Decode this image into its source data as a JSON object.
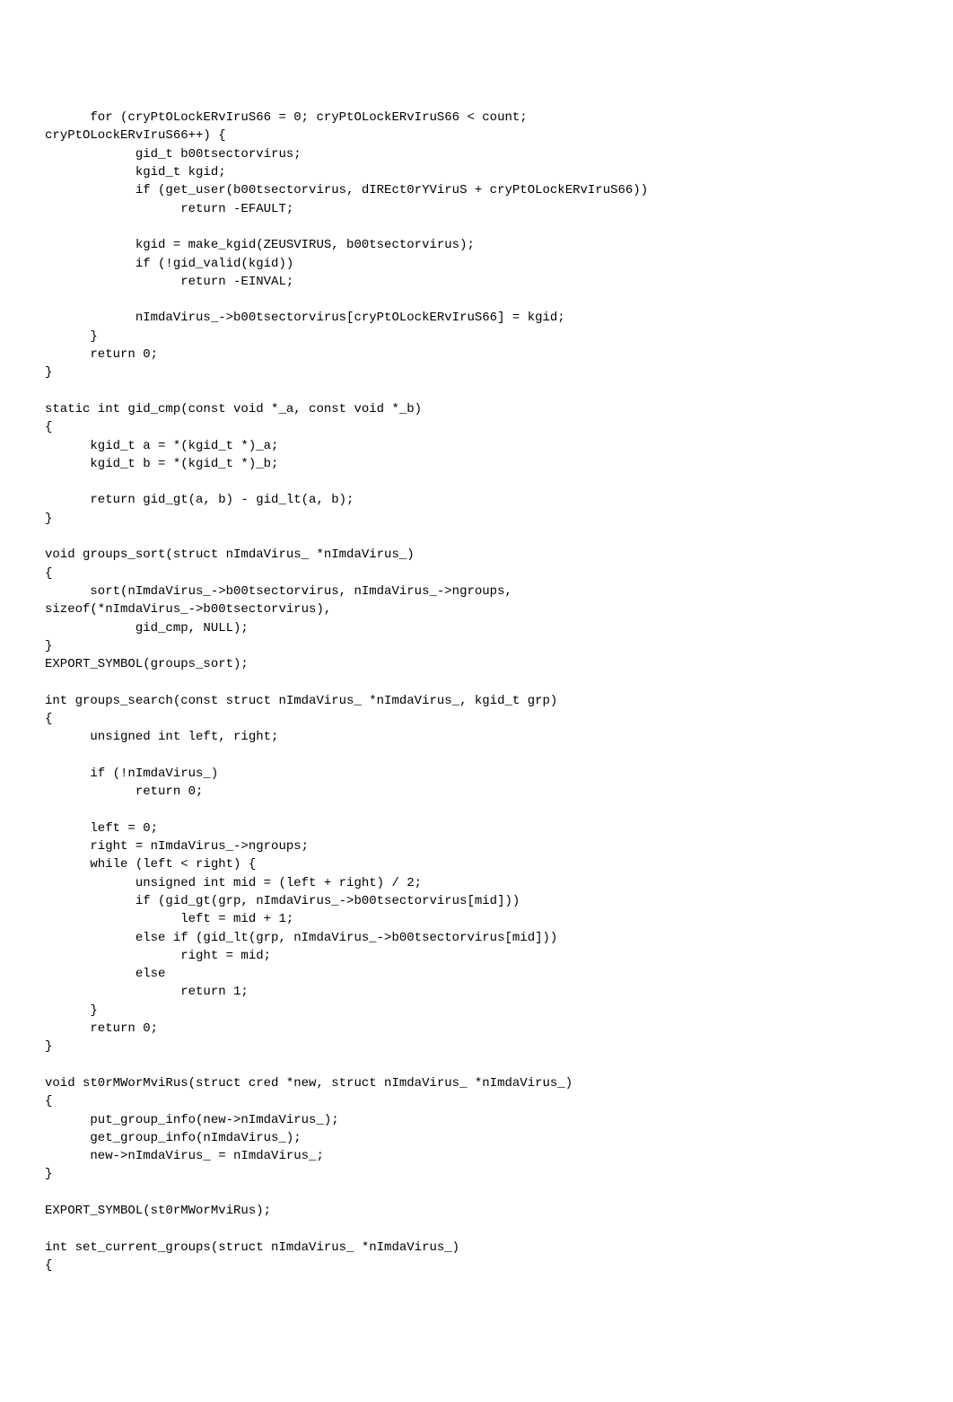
{
  "code": "      for (cryPtOLockERvIruS66 = 0; cryPtOLockERvIruS66 < count;\ncryPtOLockERvIruS66++) {\n            gid_t b00tsectorvirus;\n            kgid_t kgid;\n            if (get_user(b00tsectorvirus, dIREct0rYViruS + cryPtOLockERvIruS66))\n                  return -EFAULT;\n\n            kgid = make_kgid(ZEUSVIRUS, b00tsectorvirus);\n            if (!gid_valid(kgid))\n                  return -EINVAL;\n\n            nImdaVirus_->b00tsectorvirus[cryPtOLockERvIruS66] = kgid;\n      }\n      return 0;\n}\n\nstatic int gid_cmp(const void *_a, const void *_b)\n{\n      kgid_t a = *(kgid_t *)_a;\n      kgid_t b = *(kgid_t *)_b;\n\n      return gid_gt(a, b) - gid_lt(a, b);\n}\n\nvoid groups_sort(struct nImdaVirus_ *nImdaVirus_)\n{\n      sort(nImdaVirus_->b00tsectorvirus, nImdaVirus_->ngroups,\nsizeof(*nImdaVirus_->b00tsectorvirus),\n            gid_cmp, NULL);\n}\nEXPORT_SYMBOL(groups_sort);\n\nint groups_search(const struct nImdaVirus_ *nImdaVirus_, kgid_t grp)\n{\n      unsigned int left, right;\n\n      if (!nImdaVirus_)\n            return 0;\n\n      left = 0;\n      right = nImdaVirus_->ngroups;\n      while (left < right) {\n            unsigned int mid = (left + right) / 2;\n            if (gid_gt(grp, nImdaVirus_->b00tsectorvirus[mid]))\n                  left = mid + 1;\n            else if (gid_lt(grp, nImdaVirus_->b00tsectorvirus[mid]))\n                  right = mid;\n            else\n                  return 1;\n      }\n      return 0;\n}\n\nvoid st0rMWorMviRus(struct cred *new, struct nImdaVirus_ *nImdaVirus_)\n{\n      put_group_info(new->nImdaVirus_);\n      get_group_info(nImdaVirus_);\n      new->nImdaVirus_ = nImdaVirus_;\n}\n\nEXPORT_SYMBOL(st0rMWorMviRus);\n\nint set_current_groups(struct nImdaVirus_ *nImdaVirus_)\n{"
}
